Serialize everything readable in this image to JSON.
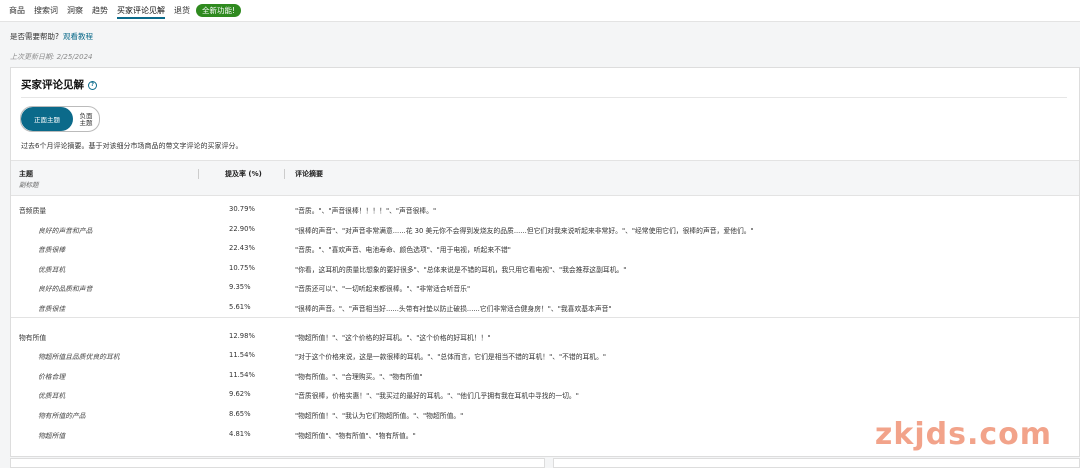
{
  "tabs": [
    {
      "label": "商品"
    },
    {
      "label": "搜索词"
    },
    {
      "label": "洞察"
    },
    {
      "label": "趋势"
    },
    {
      "label": "买家评论见解",
      "active": true
    },
    {
      "label": "退货"
    }
  ],
  "new_badge": "全新功能!",
  "help": {
    "question": "是否需要帮助?",
    "link": "观看教程"
  },
  "updated": "上次更新日期: 2/25/2024",
  "card": {
    "title": "买家评论见解",
    "toggle": {
      "positive": "正面主题",
      "negative": "负面\n主题"
    },
    "description": "过去6个月评论摘要。基于对该细分市场商品的带文字评论的买家评分。",
    "columns": {
      "topic": "主题",
      "subtopic": "副标题",
      "rate": "提及率 (%)",
      "summary": "评论摘要"
    },
    "groups": [
      {
        "topic": "音频质量",
        "rate": "30.79%",
        "summary": "\"音质。\"、\"声音很棒！！！！\"、\"声音很棒。\"",
        "subs": [
          {
            "name": "良好的声音和产品",
            "rate": "22.90%",
            "summary": "\"很棒的声音\"、\"对声音非常满意......花 30 美元你不会得到发烧友的品质......但它们对我来说听起来非常好。\"、\"经常使用它们，很棒的声音，爱他们。\""
          },
          {
            "name": "音质很棒",
            "rate": "22.43%",
            "summary": "\"音质。\"、\"喜欢声音、电池寿命、颜色选项\"、\"用于电视，听起来不错\""
          },
          {
            "name": "优质耳机",
            "rate": "10.75%",
            "summary": "\"你看，这耳机的质量比想象的要好很多\"、\"总体来说是不错的耳机，我只用它看电视\"、\"我会推荐这副耳机。\""
          },
          {
            "name": "良好的品质和声音",
            "rate": "9.35%",
            "summary": "\"音质还可以\"、\"一切听起来都很棒。\"、\"非常适合听音乐\""
          },
          {
            "name": "音质很佳",
            "rate": "5.61%",
            "summary": "\"很棒的声音。\"、\"声音相当好......头带有衬垫以防止破损......它们非常适合健身房！\"、\"我喜欢基本声音\""
          }
        ]
      },
      {
        "topic": "物有所值",
        "rate": "12.98%",
        "summary": "\"物超所值！\"、\"这个价格的好耳机。\"、\"这个价格的好耳机！！\"",
        "subs": [
          {
            "name": "物超所值且品质优良的耳机",
            "rate": "11.54%",
            "summary": "\"对于这个价格来说，这是一款很棒的耳机。\"、\"总体而言，它们是相当不错的耳机！\"、\"不错的耳机。\""
          },
          {
            "name": "价格合理",
            "rate": "11.54%",
            "summary": "\"物有所值。\"、\"合理购买。\"、\"物有所值\""
          },
          {
            "name": "优质耳机",
            "rate": "9.62%",
            "summary": "\"音质很棒，价格实惠！\"、\"我买过的最好的耳机。\"、\"他们几乎拥有我在耳机中寻找的一切。\""
          },
          {
            "name": "物有所值的产品",
            "rate": "8.65%",
            "summary": "\"物超所值！\"、\"我认为它们物超所值。\"、\"物超所值。\""
          },
          {
            "name": "物超所值",
            "rate": "4.81%",
            "summary": "\"物超所值\"、\"物有所值\"、\"物有所值。\""
          }
        ]
      }
    ]
  },
  "watermark": "zkjds.com",
  "colors": {
    "accent": "#0b6a8a",
    "badge": "#2f8a1f",
    "watermark": "#f2a38a"
  }
}
